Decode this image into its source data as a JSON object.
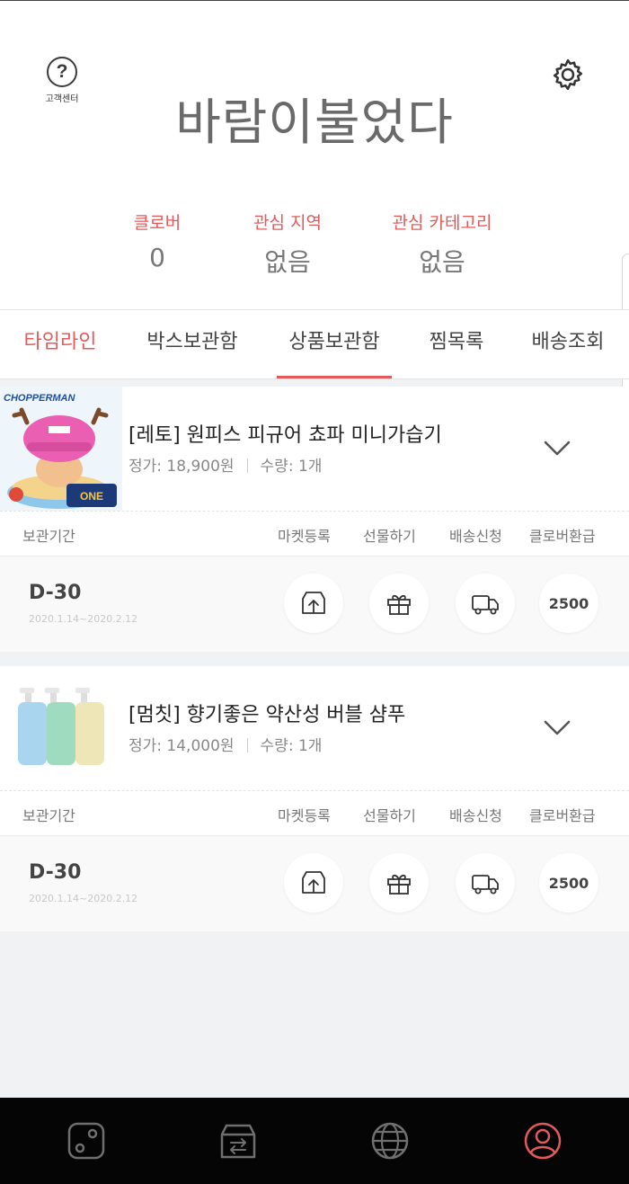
{
  "header": {
    "help_label": "고객센터",
    "title": "바람이불었다",
    "stats": [
      {
        "label": "클로버",
        "value": "0"
      },
      {
        "label": "관심 지역",
        "value": "없음"
      },
      {
        "label": "관심 카테고리",
        "value": "없음"
      }
    ]
  },
  "tabs": [
    {
      "label": "타임라인",
      "color": "#e25a5a"
    },
    {
      "label": "박스보관함"
    },
    {
      "label": "상품보관함",
      "active": true
    },
    {
      "label": "찜목록"
    },
    {
      "label": "배송조회"
    }
  ],
  "columns": {
    "period": "보관기간",
    "market": "마켓등록",
    "gift": "선물하기",
    "shipping": "배송신청",
    "refund": "클로버환급"
  },
  "products": [
    {
      "name": "[레토] 원피스 피규어 쵸파 미니가습기",
      "price": "정가: 18,900원",
      "qty": "수량: 1개",
      "thumb_text": "CHOPPERMAN",
      "dday": "D-30",
      "period": "2020.1.14~2020.2.12",
      "refund": "2500"
    },
    {
      "name": "[멈칫] 향기좋은 약산성 버블 샴푸",
      "price": "정가: 14,000원",
      "qty": "수량: 1개",
      "dday": "D-30",
      "period": "2020.1.14~2020.2.12",
      "refund": "2500"
    }
  ],
  "bottom_nav": [
    {
      "icon": "dice-icon"
    },
    {
      "icon": "box-exchange-icon"
    },
    {
      "icon": "globe-icon"
    },
    {
      "icon": "profile-icon",
      "active": true,
      "color": "#e25a5a"
    }
  ],
  "colors": {
    "accent": "#e25a5a",
    "nav_bg": "#050505"
  }
}
